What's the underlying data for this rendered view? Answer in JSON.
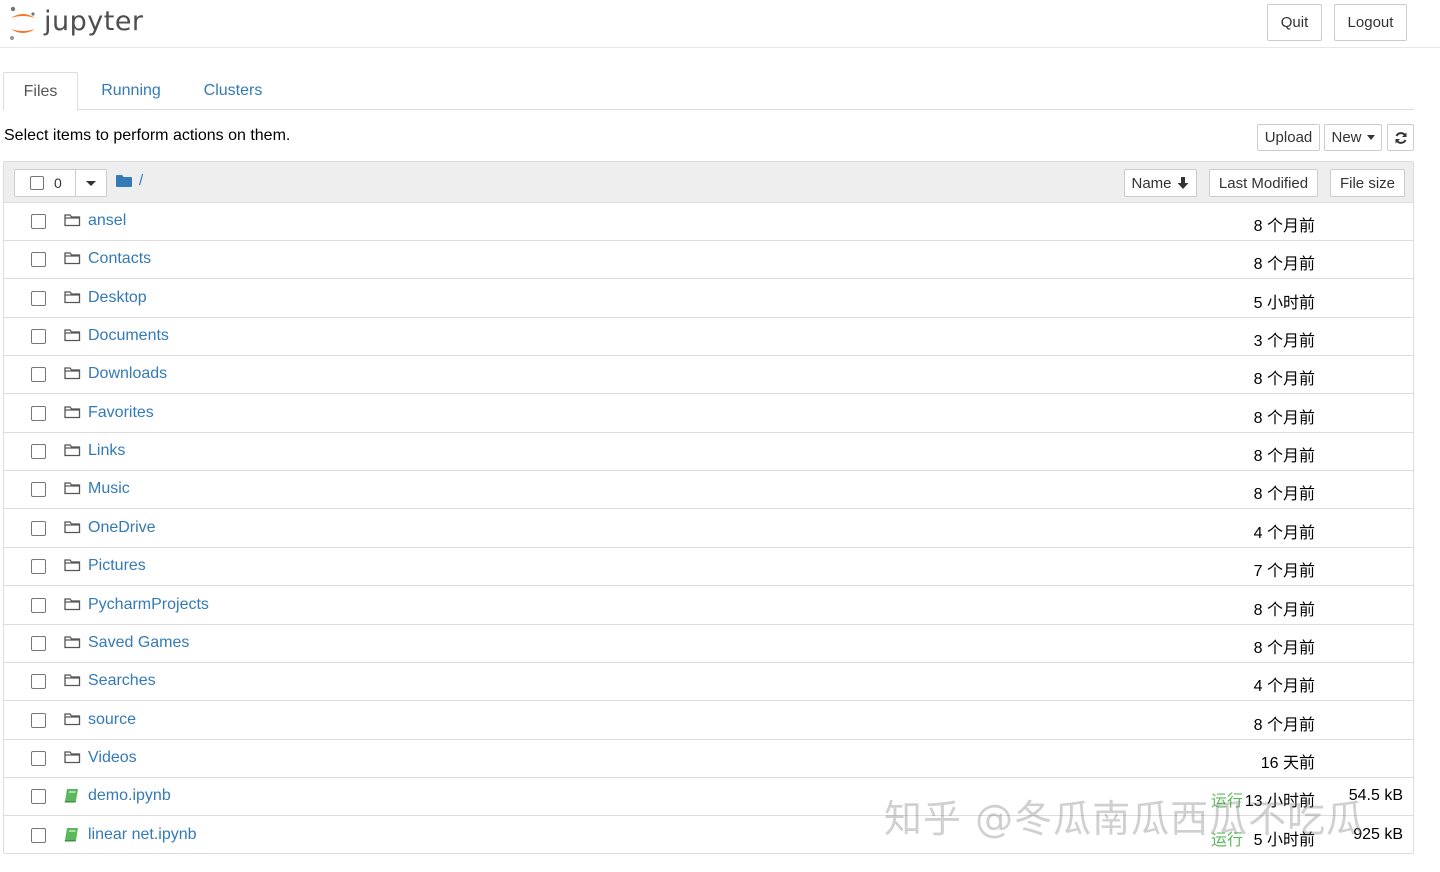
{
  "header": {
    "logo_text": "jupyter",
    "quit_label": "Quit",
    "logout_label": "Logout"
  },
  "tabs": [
    {
      "label": "Files",
      "active": true
    },
    {
      "label": "Running",
      "active": false
    },
    {
      "label": "Clusters",
      "active": false
    }
  ],
  "toolbar": {
    "instructions": "Select items to perform actions on them.",
    "upload_label": "Upload",
    "new_label": "New"
  },
  "list_header": {
    "selected_count": "0",
    "breadcrumb": "/",
    "sort_name_label": "Name",
    "sort_modified_label": "Last Modified",
    "sort_size_label": "File size"
  },
  "rows": [
    {
      "name": "ansel",
      "type": "folder",
      "modified": "8 个月前",
      "status": "",
      "size": ""
    },
    {
      "name": "Contacts",
      "type": "folder",
      "modified": "8 个月前",
      "status": "",
      "size": ""
    },
    {
      "name": "Desktop",
      "type": "folder",
      "modified": "5 小时前",
      "status": "",
      "size": ""
    },
    {
      "name": "Documents",
      "type": "folder",
      "modified": "3 个月前",
      "status": "",
      "size": ""
    },
    {
      "name": "Downloads",
      "type": "folder",
      "modified": "8 个月前",
      "status": "",
      "size": ""
    },
    {
      "name": "Favorites",
      "type": "folder",
      "modified": "8 个月前",
      "status": "",
      "size": ""
    },
    {
      "name": "Links",
      "type": "folder",
      "modified": "8 个月前",
      "status": "",
      "size": ""
    },
    {
      "name": "Music",
      "type": "folder",
      "modified": "8 个月前",
      "status": "",
      "size": ""
    },
    {
      "name": "OneDrive",
      "type": "folder",
      "modified": "4 个月前",
      "status": "",
      "size": ""
    },
    {
      "name": "Pictures",
      "type": "folder",
      "modified": "7 个月前",
      "status": "",
      "size": ""
    },
    {
      "name": "PycharmProjects",
      "type": "folder",
      "modified": "8 个月前",
      "status": "",
      "size": ""
    },
    {
      "name": "Saved Games",
      "type": "folder",
      "modified": "8 个月前",
      "status": "",
      "size": ""
    },
    {
      "name": "Searches",
      "type": "folder",
      "modified": "4 个月前",
      "status": "",
      "size": ""
    },
    {
      "name": "source",
      "type": "folder",
      "modified": "8 个月前",
      "status": "",
      "size": ""
    },
    {
      "name": "Videos",
      "type": "folder",
      "modified": "16 天前",
      "status": "",
      "size": ""
    },
    {
      "name": "demo.ipynb",
      "type": "notebook",
      "modified": "13 小时前",
      "status": "运行",
      "size": "54.5 kB"
    },
    {
      "name": "linear net.ipynb",
      "type": "notebook",
      "modified": "5 小时前",
      "status": "运行",
      "size": "925 kB"
    }
  ],
  "watermark": "知乎 @冬瓜南瓜西瓜不吃瓜",
  "colors": {
    "link": "#337ab7",
    "running": "#5cb85c",
    "logo_orange": "#f37726"
  }
}
